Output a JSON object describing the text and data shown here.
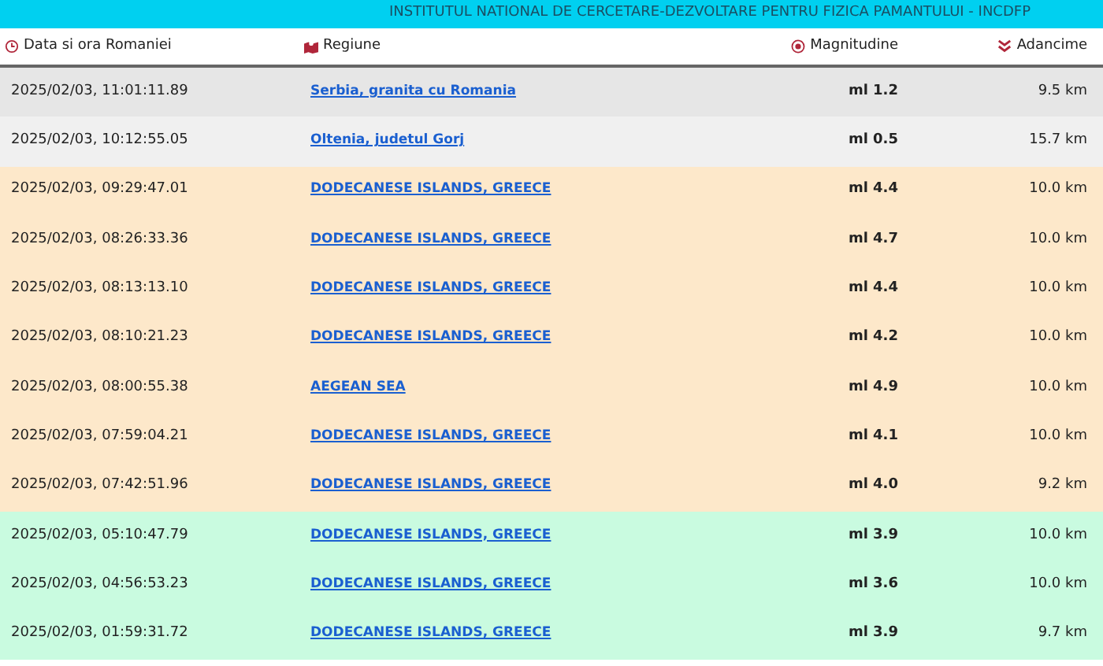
{
  "banner": {
    "title": "INSTITUTUL NATIONAL DE CERCETARE-DEZVOLTARE PENTRU FIZICA PAMANTULUI - INCDFP"
  },
  "table": {
    "columns": [
      {
        "label": "Data si ora Romaniei",
        "kind": "clock"
      },
      {
        "label": "Regiune",
        "kind": "map"
      },
      {
        "label": "Magnitudine",
        "kind": "target"
      },
      {
        "label": "Adancime",
        "kind": "chevrons"
      }
    ],
    "rows": [
      {
        "time": "2025/02/03, 11:01:11.89",
        "region": "Serbia, granita cu Romania",
        "magnitude": "ml 1.2",
        "depth": "9.5 km",
        "color": "#e6e6e6"
      },
      {
        "time": "2025/02/03, 10:12:55.05",
        "region": "Oltenia, judetul Gorj",
        "magnitude": "ml 0.5",
        "depth": "15.7 km",
        "color": "#f0f0f0"
      },
      {
        "time": "2025/02/03, 09:29:47.01",
        "region": "DODECANESE ISLANDS, GREECE",
        "magnitude": "ml 4.4",
        "depth": "10.0 km",
        "color": "#fde8ca"
      },
      {
        "time": "2025/02/03, 08:26:33.36",
        "region": "DODECANESE ISLANDS, GREECE",
        "magnitude": "ml 4.7",
        "depth": "10.0 km",
        "color": "#fde8ca"
      },
      {
        "time": "2025/02/03, 08:13:13.10",
        "region": "DODECANESE ISLANDS, GREECE",
        "magnitude": "ml 4.4",
        "depth": "10.0 km",
        "color": "#fde8ca"
      },
      {
        "time": "2025/02/03, 08:10:21.23",
        "region": "DODECANESE ISLANDS, GREECE",
        "magnitude": "ml 4.2",
        "depth": "10.0 km",
        "color": "#fde8ca"
      },
      {
        "time": "2025/02/03, 08:00:55.38",
        "region": "AEGEAN SEA",
        "magnitude": "ml 4.9",
        "depth": "10.0 km",
        "color": "#fde8ca"
      },
      {
        "time": "2025/02/03, 07:59:04.21",
        "region": "DODECANESE ISLANDS, GREECE",
        "magnitude": "ml 4.1",
        "depth": "10.0 km",
        "color": "#fde8ca"
      },
      {
        "time": "2025/02/03, 07:42:51.96",
        "region": "DODECANESE ISLANDS, GREECE",
        "magnitude": "ml 4.0",
        "depth": "9.2 km",
        "color": "#fde8ca"
      },
      {
        "time": "2025/02/03, 05:10:47.79",
        "region": "DODECANESE ISLANDS, GREECE",
        "magnitude": "ml 3.9",
        "depth": "10.0 km",
        "color": "#c9fbe0"
      },
      {
        "time": "2025/02/03, 04:56:53.23",
        "region": "DODECANESE ISLANDS, GREECE",
        "magnitude": "ml 3.6",
        "depth": "10.0 km",
        "color": "#c9fbe0"
      },
      {
        "time": "2025/02/03, 01:59:31.72",
        "region": "DODECANESE ISLANDS, GREECE",
        "magnitude": "ml 3.9",
        "depth": "9.7 km",
        "color": "#c9fbe0"
      }
    ]
  }
}
